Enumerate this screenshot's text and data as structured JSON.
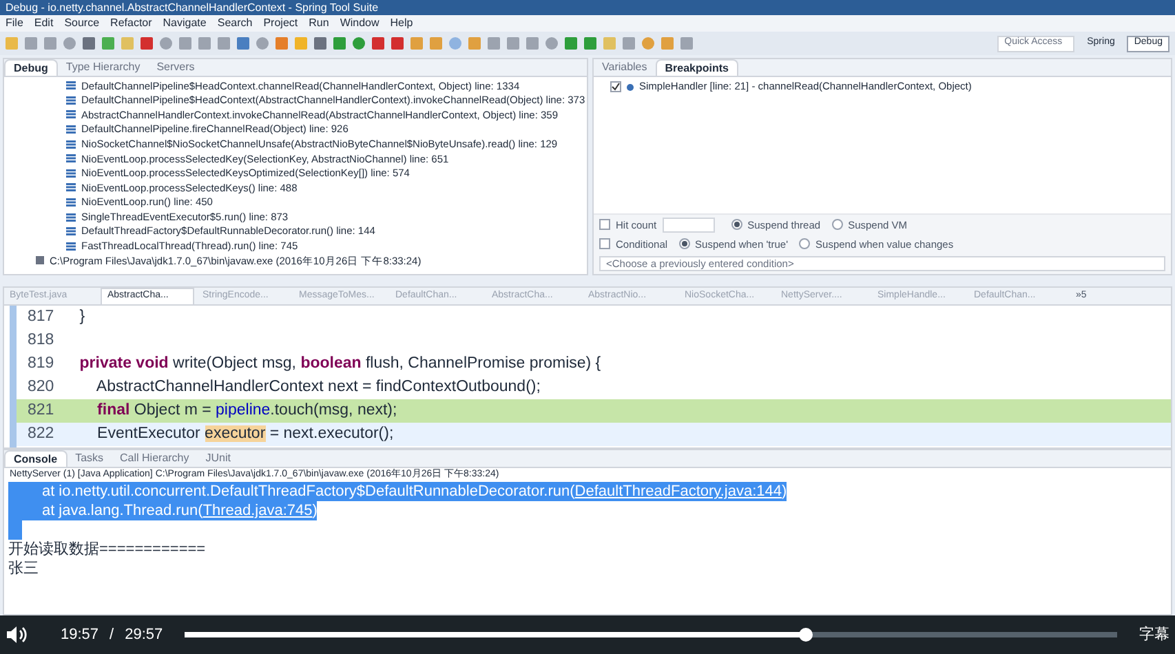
{
  "window": {
    "title": "Debug - io.netty.channel.AbstractChannelHandlerContext - Spring Tool Suite"
  },
  "menu": [
    "File",
    "Edit",
    "Source",
    "Refactor",
    "Navigate",
    "Search",
    "Project",
    "Run",
    "Window",
    "Help"
  ],
  "quick_access": {
    "placeholder": "Quick Access"
  },
  "perspectives": [
    {
      "label": "Spring",
      "selected": false
    },
    {
      "label": "Debug",
      "selected": true
    }
  ],
  "debug_panel": {
    "tabs": [
      {
        "label": "Debug",
        "selected": true
      },
      {
        "label": "Type Hierarchy",
        "selected": false
      },
      {
        "label": "Servers",
        "selected": false
      }
    ],
    "frames": [
      "DefaultChannelPipeline$HeadContext.channelRead(ChannelHandlerContext, Object) line: 1334",
      "DefaultChannelPipeline$HeadContext(AbstractChannelHandlerContext).invokeChannelRead(Object) line: 373",
      "AbstractChannelHandlerContext.invokeChannelRead(AbstractChannelHandlerContext, Object) line: 359",
      "DefaultChannelPipeline.fireChannelRead(Object) line: 926",
      "NioSocketChannel$NioSocketChannelUnsafe(AbstractNioByteChannel$NioByteUnsafe).read() line: 129",
      "NioEventLoop.processSelectedKey(SelectionKey, AbstractNioChannel) line: 651",
      "NioEventLoop.processSelectedKeysOptimized(SelectionKey[]) line: 574",
      "NioEventLoop.processSelectedKeys() line: 488",
      "NioEventLoop.run() line: 450",
      "SingleThreadEventExecutor$5.run() line: 873",
      "DefaultThreadFactory$DefaultRunnableDecorator.run() line: 144",
      "FastThreadLocalThread(Thread).run() line: 745"
    ],
    "process": "C:\\Program Files\\Java\\jdk1.7.0_67\\bin\\javaw.exe (2016年10月26日 下午8:33:24)"
  },
  "breakpoints_panel": {
    "tabs": [
      {
        "label": "Variables",
        "selected": false
      },
      {
        "label": "Breakpoints",
        "selected": true
      }
    ],
    "breakpoints": [
      {
        "label": "SimpleHandler [line: 21] - channelRead(ChannelHandlerContext, Object)",
        "checked": true
      }
    ],
    "hit_count": {
      "label": "Hit count",
      "checked": false
    },
    "suspend_scope": [
      {
        "label": "Suspend thread",
        "selected": true
      },
      {
        "label": "Suspend VM",
        "selected": false
      }
    ],
    "conditional": {
      "label": "Conditional",
      "checked": false
    },
    "suspend_when": [
      {
        "label": "Suspend when 'true'",
        "selected": true
      },
      {
        "label": "Suspend when value changes",
        "selected": false
      }
    ],
    "condition": {
      "placeholder": "<Choose a previously entered condition>"
    }
  },
  "editor": {
    "tabs": [
      {
        "label": "ByteTest.java",
        "selected": false
      },
      {
        "label": "AbstractCha...",
        "selected": true
      },
      {
        "label": "StringEncode...",
        "selected": false
      },
      {
        "label": "MessageToMes...",
        "selected": false
      },
      {
        "label": "DefaultChan...",
        "selected": false
      },
      {
        "label": "AbstractCha...",
        "selected": false
      },
      {
        "label": "AbstractNio...",
        "selected": false
      },
      {
        "label": "NioSocketCha...",
        "selected": false
      },
      {
        "label": "NettyServer....",
        "selected": false
      },
      {
        "label": "SimpleHandle...",
        "selected": false
      },
      {
        "label": "DefaultChan...",
        "selected": false
      }
    ],
    "overflow": "»5",
    "lines": [
      {
        "number": "817",
        "kind": "plain",
        "tokens": [
          {
            "kind": "text",
            "text": "    }"
          }
        ]
      },
      {
        "number": "818",
        "kind": "plain"
      },
      {
        "number": "819",
        "kind": "plain",
        "tokens": [
          {
            "kind": "keyword",
            "text": "    private void"
          },
          {
            "kind": "text",
            "text": " write(Object msg, "
          },
          {
            "kind": "keyword",
            "text": "boolean"
          },
          {
            "kind": "text",
            "text": " flush, ChannelPromise promise) {"
          }
        ]
      },
      {
        "number": "820",
        "kind": "plain",
        "tokens": [
          {
            "kind": "text",
            "text": "        AbstractChannelHandlerContext next = findContextOutbound();"
          }
        ]
      },
      {
        "number": "821",
        "kind": "current",
        "tokens": [
          {
            "kind": "keyword",
            "text": "        final"
          },
          {
            "kind": "text",
            "text": " Object m = "
          },
          {
            "kind": "field",
            "text": "pipeline"
          },
          {
            "kind": "text",
            "text": ".touch(msg, next);"
          }
        ]
      },
      {
        "number": "822",
        "kind": "cursor",
        "tokens": [
          {
            "kind": "text",
            "text": "        EventExecutor "
          },
          {
            "kind": "occurrence",
            "text": "executor"
          },
          {
            "kind": "text",
            "text": " = next.executor();"
          }
        ]
      }
    ]
  },
  "console": {
    "tabs": [
      {
        "label": "Console",
        "selected": true
      },
      {
        "label": "Tasks",
        "selected": false
      },
      {
        "label": "Call Hierarchy",
        "selected": false
      },
      {
        "label": "JUnit",
        "selected": false
      }
    ],
    "process": "NettyServer (1) [Java Application] C:\\Program Files\\Java\\jdk1.7.0_67\\bin\\javaw.exe (2016年10月26日 下午8:33:24)",
    "lines": [
      {
        "selected": true,
        "tokens": [
          {
            "kind": "text",
            "text": "        at io.netty.util.concurrent.DefaultThreadFactory$DefaultRunnableDecorator.run("
          },
          {
            "kind": "link",
            "text": "DefaultThreadFactory.java:144"
          },
          {
            "kind": "text",
            "text": ")"
          }
        ]
      },
      {
        "selected": true,
        "tokens": [
          {
            "kind": "text",
            "text": "        at java.lang.Thread.run("
          },
          {
            "kind": "link",
            "text": "Thread.java:745"
          },
          {
            "kind": "text",
            "text": ")"
          }
        ]
      },
      {
        "selected": true
      },
      {
        "selected": false,
        "tokens": [
          {
            "kind": "text",
            "text": "开始读取数据============"
          }
        ]
      },
      {
        "selected": false,
        "tokens": [
          {
            "kind": "text",
            "text": "张三"
          }
        ]
      }
    ]
  },
  "player": {
    "current": "19:57",
    "separator": "/",
    "duration": "29:57",
    "level": 0.666,
    "subtitles": "字幕"
  }
}
